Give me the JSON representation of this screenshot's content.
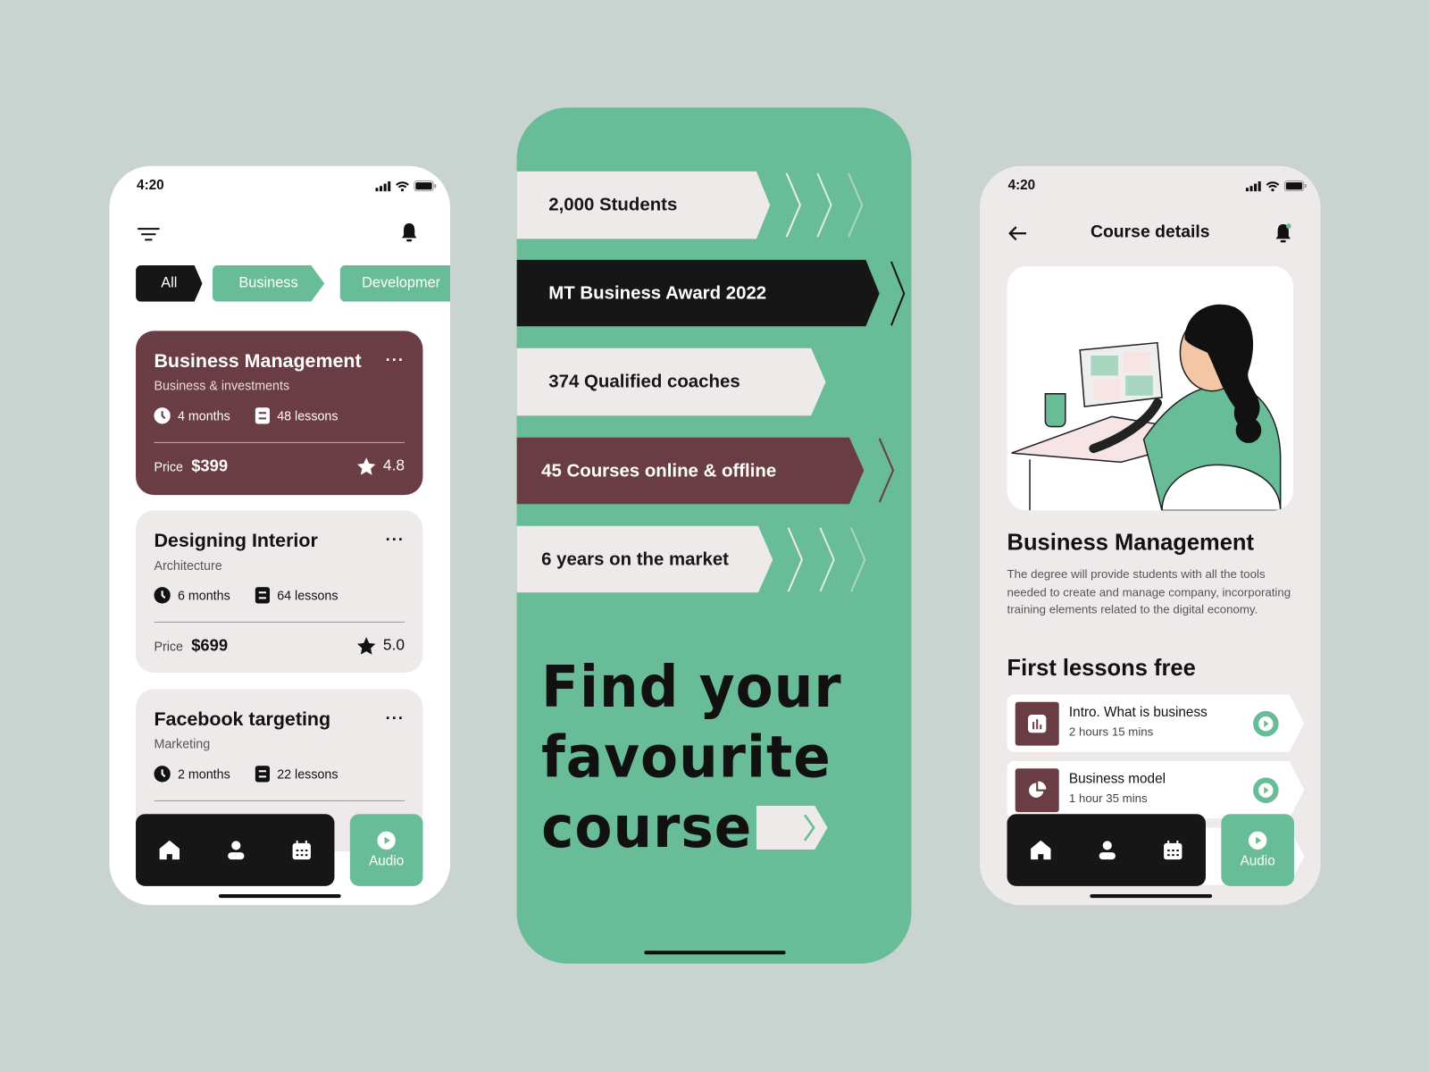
{
  "colors": {
    "background": "#c9d3cf",
    "green": "#68bc98",
    "maroon": "#6a3c43",
    "dark": "#161616",
    "light": "#efeaea"
  },
  "left_phone": {
    "status": {
      "time": "4:20"
    },
    "header": {
      "menu_icon": "filter-icon",
      "bell_icon": "bell-icon"
    },
    "chips": [
      {
        "label": "All",
        "active": true
      },
      {
        "label": "Business"
      },
      {
        "label": "Developmer"
      }
    ],
    "courses": [
      {
        "title": "Business Management",
        "category": "Business & investments",
        "duration": "4 months",
        "lessons": "48 lessons",
        "price_label": "Price",
        "price": "$399",
        "rating": "4.8"
      },
      {
        "title": "Designing Interior",
        "category": "Architecture",
        "duration": "6 months",
        "lessons": "64 lessons",
        "price_label": "Price",
        "price": "$699",
        "rating": "5.0"
      },
      {
        "title": "Facebook targeting",
        "category": "Marketing",
        "duration": "2 months",
        "lessons": "22 lessons"
      }
    ],
    "nav": {
      "items": [
        "home-icon",
        "profile-icon",
        "calendar-icon"
      ],
      "audio_label": "Audio"
    }
  },
  "middle_phone": {
    "stats": [
      "2,000 Students",
      "MT Business Award 2022",
      "374 Qualified coaches",
      "45 Courses online & offline",
      "6 years on the market"
    ],
    "headline": [
      "Find your",
      "favourite",
      "course"
    ]
  },
  "right_phone": {
    "status": {
      "time": "4:20"
    },
    "header": {
      "title": "Course details"
    },
    "course": {
      "title": "Business Management",
      "description": "The degree will provide students with all the tools needed to create and manage company, incorporating training elements related to the digital economy."
    },
    "lessons_heading": "First lessons free",
    "lessons": [
      {
        "title": "Intro. What is business",
        "duration": "2 hours 15 mins",
        "icon": "bar-chart-icon"
      },
      {
        "title": "Business model",
        "duration": "1 hour 35 mins",
        "icon": "pie-chart-icon"
      }
    ],
    "nav": {
      "audio_label": "Audio"
    }
  }
}
